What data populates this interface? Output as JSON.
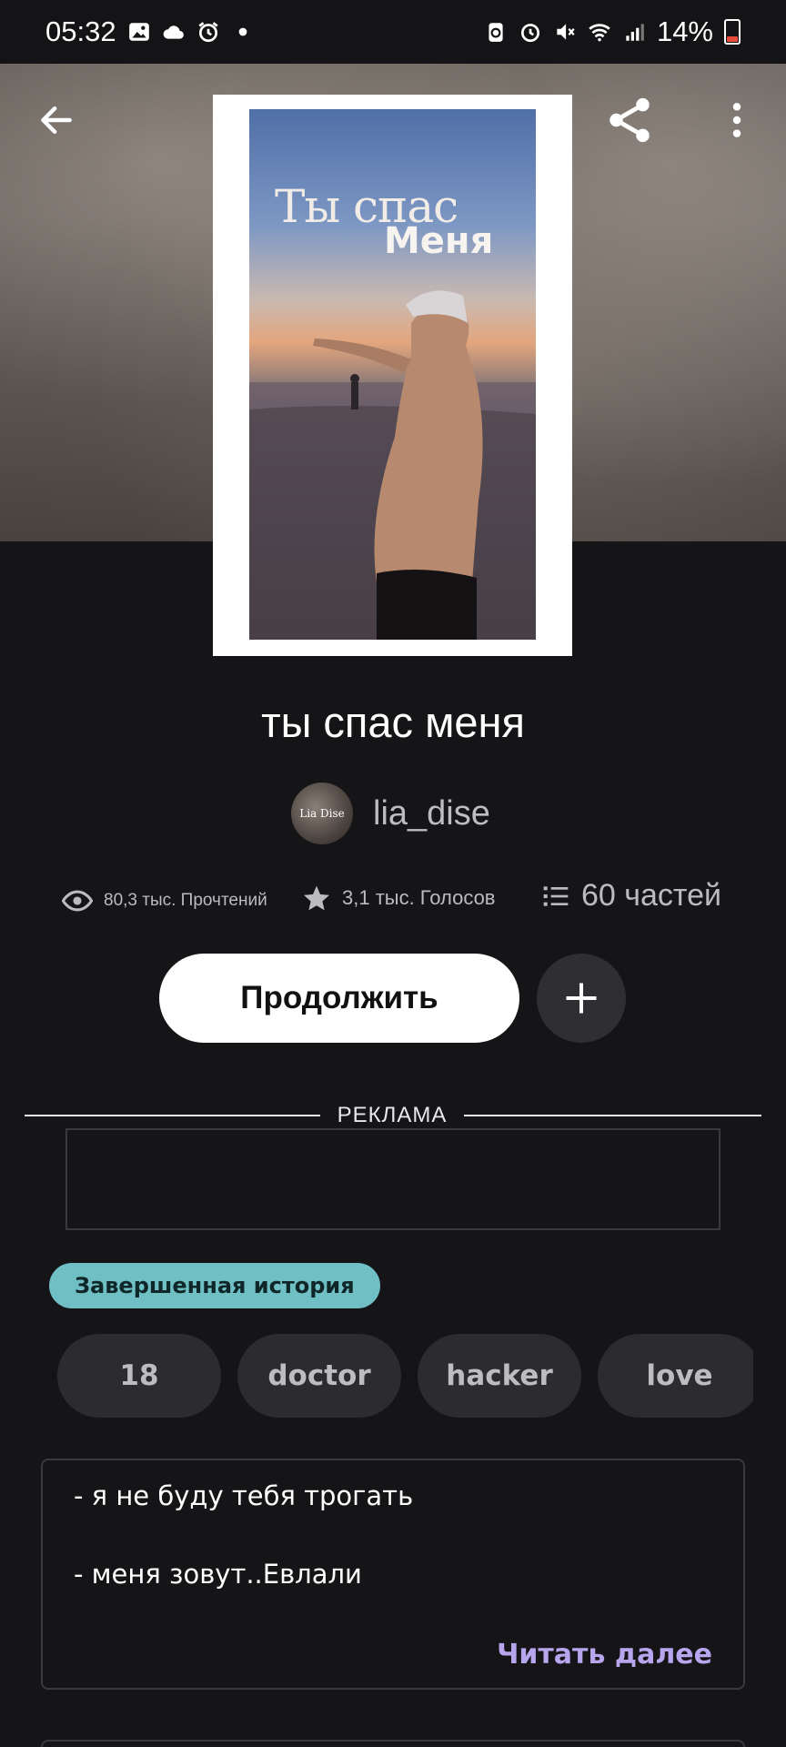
{
  "status_bar": {
    "time": "05:32",
    "left_icons": [
      "gallery-icon",
      "cloud-icon",
      "alarm-icon",
      "dot-icon"
    ],
    "right_icons": [
      "battery-saver-icon",
      "alarm-icon",
      "mute-icon",
      "wifi-icon",
      "signal-icon"
    ],
    "battery": "14%",
    "battery_color": "#e74c3c"
  },
  "toolbar": {
    "back_icon": "arrow-left-icon",
    "share_icon": "share-icon",
    "more_icon": "more-vertical-icon"
  },
  "cover": {
    "title_line1": "Ты спас",
    "title_line2": "Меня"
  },
  "story": {
    "title": "ты спас меня",
    "author": "lia_dise",
    "avatar_text": "Lia Dise"
  },
  "stats": {
    "reads": "80,3 тыс. Прочтений",
    "votes": "3,1 тыс. Голосов",
    "parts": "60 частей"
  },
  "actions": {
    "continue_label": "Продолжить",
    "add_icon": "plus-icon"
  },
  "ad": {
    "label": "РЕКЛАМА"
  },
  "badge": {
    "label": "Завершенная история",
    "color": "#6fbfc4"
  },
  "tags": [
    "18",
    "doctor",
    "hacker",
    "love"
  ],
  "description": {
    "lines": [
      "- я не буду тебя трогать",
      "- меня зовут..Евлали"
    ],
    "read_more": "Читать далее",
    "read_more_color": "#b7a6ee"
  }
}
